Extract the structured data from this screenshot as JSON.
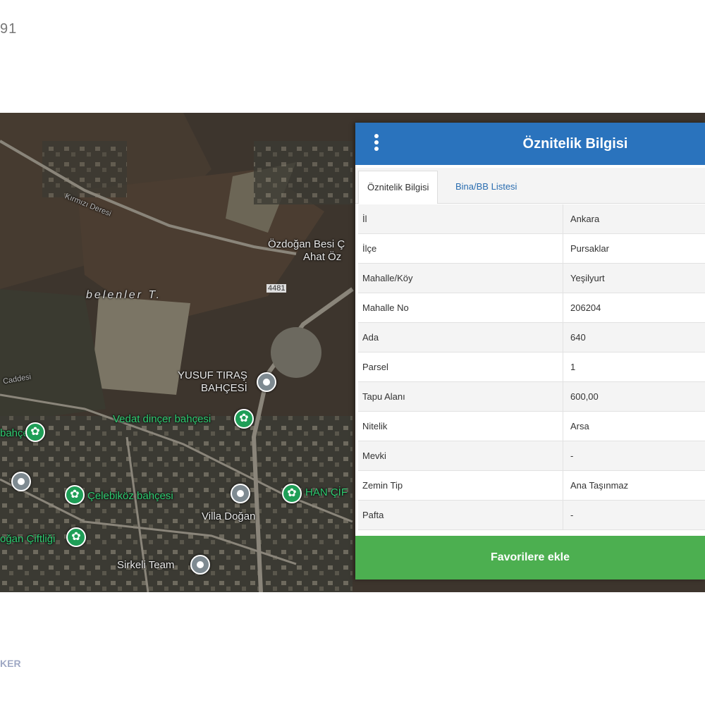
{
  "header_number": "91",
  "footer_text": "KER",
  "map": {
    "labels": {
      "ozdogan": "Özdoğan Besi Ç",
      "ahat": "Ahat Öz",
      "road_number": "4481",
      "belenler": "belenler T.",
      "yusuf": "YUSUF TIRAŞ",
      "bahcesi": "BAHÇESİ",
      "vedat": "Vedat dinçer bahçesi",
      "celebi": "Çelebiköz bahçesi",
      "villa": "Villa Doğan",
      "sirkeli": "Sirkeli Team",
      "han": "HAN ÇİF",
      "dogan": "oğan Çiftliği",
      "sol_bahce": "bahçesi",
      "road_top": "Kırmızı Deresi",
      "road_low": "Caddesi"
    }
  },
  "panel": {
    "title": "Öznitelik Bilgisi",
    "menu_icon": "vertical-dots-icon",
    "tabs": [
      {
        "label": "Öznitelik Bilgisi",
        "active": true
      },
      {
        "label": "Bina/BB Listesi",
        "active": false
      }
    ],
    "rows": [
      {
        "key": "İl",
        "value": "Ankara"
      },
      {
        "key": "İlçe",
        "value": "Pursaklar"
      },
      {
        "key": "Mahalle/Köy",
        "value": "Yeşilyurt"
      },
      {
        "key": "Mahalle No",
        "value": "206204"
      },
      {
        "key": "Ada",
        "value": "640"
      },
      {
        "key": "Parsel",
        "value": "1"
      },
      {
        "key": "Tapu Alanı",
        "value": "600,00"
      },
      {
        "key": "Nitelik",
        "value": "Arsa"
      },
      {
        "key": "Mevki",
        "value": "-"
      },
      {
        "key": "Zemin Tip",
        "value": "Ana Taşınmaz"
      },
      {
        "key": "Pafta",
        "value": "-"
      }
    ],
    "favorite_button": "Favorilere ekle"
  },
  "colors": {
    "header_blue": "#2a73bd",
    "button_green": "#4caf50",
    "tab_link": "#2a6db0"
  }
}
